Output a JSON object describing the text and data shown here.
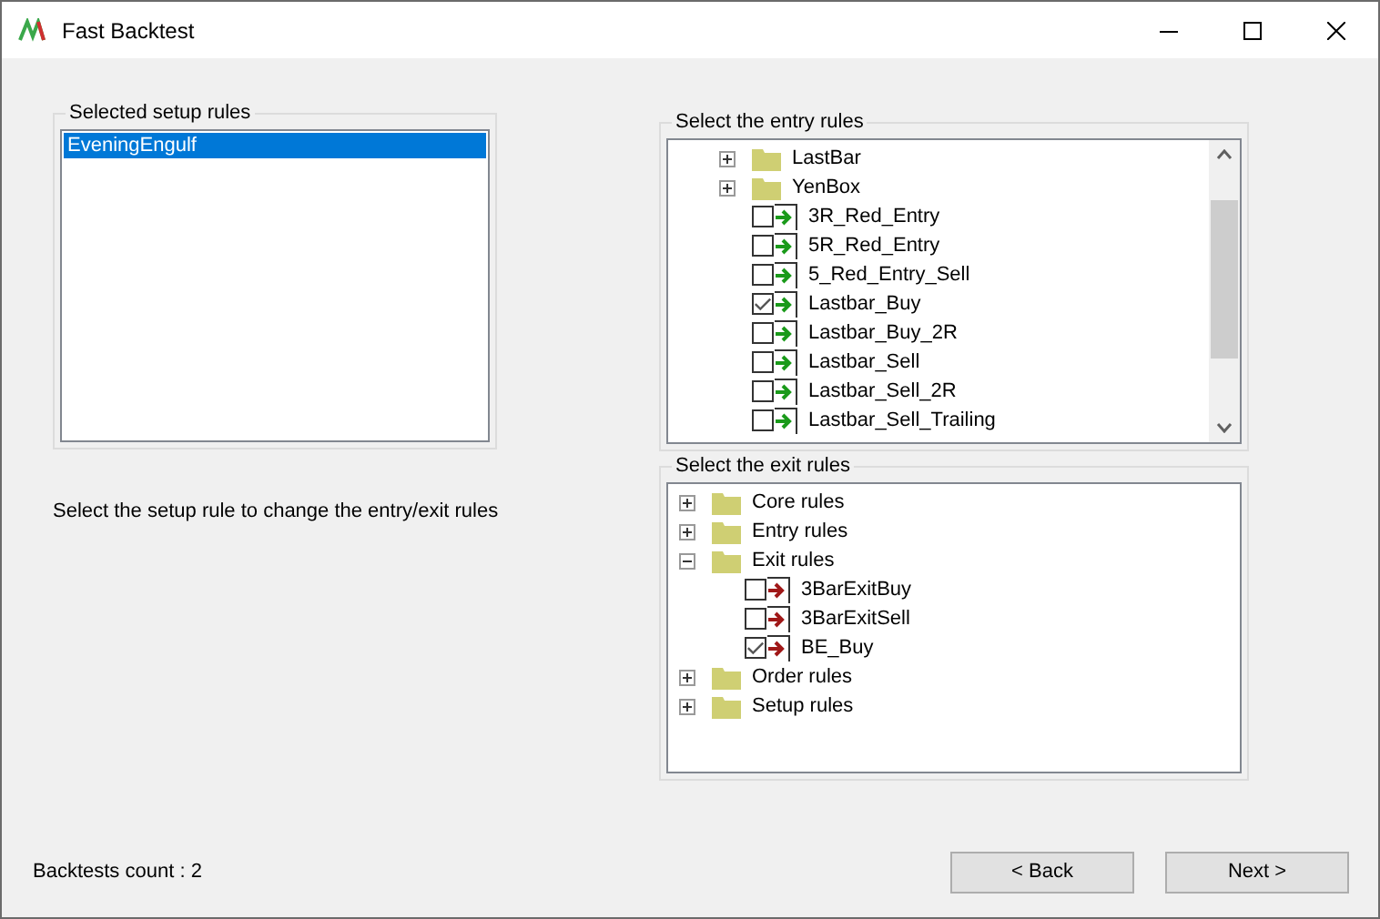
{
  "window": {
    "title": "Fast Backtest"
  },
  "setup_rules": {
    "title": "Selected setup rules",
    "items": [
      {
        "label": "EveningEngulf",
        "selected": true
      }
    ]
  },
  "hint": "Select the setup rule to change the entry/exit rules",
  "entry_rules": {
    "title": "Select the entry rules",
    "items": [
      {
        "kind": "folder",
        "label": "LastBar",
        "expanded": false
      },
      {
        "kind": "folder",
        "label": "YenBox",
        "expanded": false
      },
      {
        "kind": "rule",
        "label": "3R_Red_Entry",
        "checked": false
      },
      {
        "kind": "rule",
        "label": "5R_Red_Entry",
        "checked": false
      },
      {
        "kind": "rule",
        "label": "5_Red_Entry_Sell",
        "checked": false
      },
      {
        "kind": "rule",
        "label": "Lastbar_Buy",
        "checked": true
      },
      {
        "kind": "rule",
        "label": "Lastbar_Buy_2R",
        "checked": false
      },
      {
        "kind": "rule",
        "label": "Lastbar_Sell",
        "checked": false
      },
      {
        "kind": "rule",
        "label": "Lastbar_Sell_2R",
        "checked": false
      },
      {
        "kind": "rule",
        "label": "Lastbar_Sell_Trailing",
        "checked": false
      }
    ]
  },
  "exit_rules": {
    "title": "Select the exit rules",
    "items": [
      {
        "label": "Core rules",
        "expanded": false
      },
      {
        "label": "Entry rules",
        "expanded": false
      },
      {
        "label": "Exit rules",
        "expanded": true,
        "children": [
          {
            "label": "3BarExitBuy",
            "checked": false
          },
          {
            "label": "3BarExitSell",
            "checked": false
          },
          {
            "label": "BE_Buy",
            "checked": true
          }
        ]
      },
      {
        "label": "Order rules",
        "expanded": false
      },
      {
        "label": "Setup rules",
        "expanded": false
      }
    ]
  },
  "status": "Backtests count : 2",
  "buttons": [
    "< Back",
    "Next >"
  ]
}
